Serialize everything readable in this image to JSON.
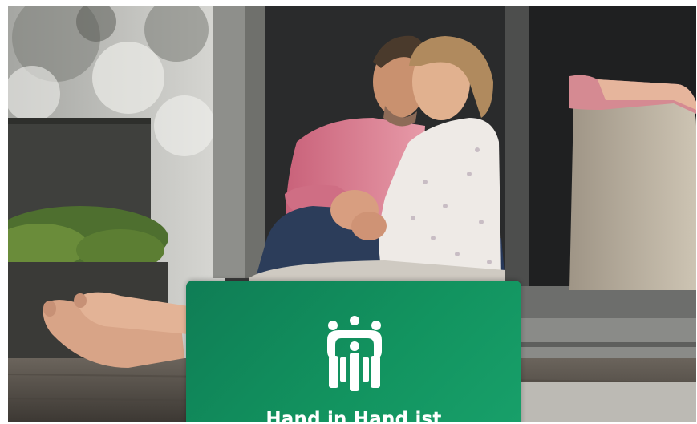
{
  "card": {
    "headline": "Hand in Hand ist",
    "background_color": "#12935f"
  },
  "logo": {
    "name": "people-circle-logo",
    "color": "#ffffff"
  }
}
